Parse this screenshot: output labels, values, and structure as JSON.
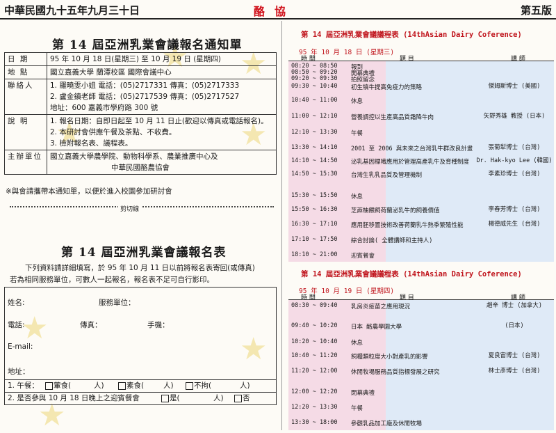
{
  "header": {
    "left": "中華民國九十五年九月三十日",
    "mid": "酪協",
    "right": "第五版"
  },
  "notice": {
    "title": "第 14 屆亞洲乳業會議報名通知單",
    "rows": [
      {
        "label": "日 期",
        "lines": [
          "95 年 10 月 18 日(星期三) 至 10 月 19 日 (星期四)"
        ]
      },
      {
        "label": "地 點",
        "lines": [
          "國立嘉義大學  蘭潭校區  國際會議中心"
        ]
      },
      {
        "label": "聯絡人",
        "lines": [
          "1.   羅曉雯小姐  電話：(05)2717331  傳真：(05)2717333",
          "2.   盧金鎮老師  電話：(05)2717539  傳真：(05)2717527",
          "地址：600 嘉義市學府路 300 號"
        ]
      },
      {
        "label": "說 明",
        "lines": [
          "1.   報名日期：自即日起至 10 月 11 日止(歡迎以傳真或電話報名)。",
          "2.   本研討會供應午餐及茶點、不收費。",
          "3.   檢附報名表、議程表。"
        ]
      },
      {
        "label": "主辦單位",
        "lines": [
          "國立嘉義大學農學院、動物科學系、農業推廣中心及",
          "中華民國酪農協會"
        ]
      }
    ],
    "note": "※與會請攜帶本通知單，以便於進入校園參加研討會"
  },
  "cut_label": "剪切線",
  "registration": {
    "title": "第 14 屆亞洲乳業會議報名表",
    "desc1": "下列資料請詳細填寫，於 95 年 10 月 11 日以前將報名表寄回(或傳真)",
    "desc2": "若為相同服務單位，可數人一起報名，報名表不足可自行影印。",
    "name": "姓名:",
    "unit": "服務單位：",
    "phone": "電話:",
    "fax": "傳真：",
    "mobile": "手機：",
    "email": "E-mail:",
    "address": "地址：",
    "lunch": {
      "label": "1. 午餐：",
      "o1": "葷食(",
      "o2": "素食(",
      "o3": "不拘(",
      "unit": "人)"
    },
    "dinner": {
      "label": "2. 是否參與 10 月 18 日晚上之迎賓餐會",
      "yes": "是(",
      "unit": "人)",
      "no": "否"
    }
  },
  "schedule1": {
    "title": "第 14 屆亞洲乳業會議議程表 (14thAsian Dairy Coference)",
    "date": "95 年 10 月 18 日 (星期三)",
    "head": {
      "time": "時  間",
      "topic": "題    目",
      "speaker": "講    師"
    },
    "rows": [
      {
        "time": "08:20 ~ 08:50",
        "topic": "報到",
        "speaker": ""
      },
      {
        "time": "08:50 ~ 09:20",
        "topic": "開幕典禮",
        "speaker": ""
      },
      {
        "time": "09:20 ~ 09:30",
        "topic": "拍照留念",
        "speaker": ""
      },
      {
        "time": "09:30 ~ 10:40",
        "topic": "初生犢牛提高免疫力的策略",
        "speaker": "傑姆斯博士 (美國)"
      },
      {
        "time": "10:40 ~ 11:00",
        "topic": "休息",
        "speaker": ""
      },
      {
        "time": "11:00 ~ 12:10",
        "topic": "營養調控以生產高品質霜降牛肉",
        "speaker": "矢野秀雄 教授 (日本)"
      },
      {
        "time": "12:10 ~ 13:30",
        "topic": "午餐",
        "speaker": ""
      },
      {
        "time": "13:30 ~ 14:10",
        "topic": "2001 至 2006 與未來之台灣乳牛群改良計畫",
        "speaker": "張菊犁博士 (台灣)"
      },
      {
        "time": "14:10 ~ 14:50",
        "topic": "泌乳基因標幟應用於管理高產乳牛及育種制度",
        "speaker": "Dr. Hak-kyo Lee (韓國)"
      },
      {
        "time": "14:50 ~ 15:30",
        "topic": "台灣生乳乳品質及管理機制",
        "speaker": "李素珍博士 (台灣)"
      },
      {
        "time": "15:30 ~ 15:50",
        "topic": "休息",
        "speaker": ""
      },
      {
        "time": "15:50 ~ 16:30",
        "topic": "芝蔴柚餵飼荷蘭泌乳牛的飼養價值",
        "speaker": "李春芳博士 (台灣)"
      },
      {
        "time": "16:30 ~ 17:10",
        "topic": "應用胚移置技術改善荷蘭乳牛熱季繁殖性能",
        "speaker": "楊德威先生 (台灣)"
      },
      {
        "time": "17:10 ~ 17:50",
        "topic": "綜合討論( 全體講師和主持人)",
        "speaker": ""
      },
      {
        "time": "18:10 ~ 21:00",
        "topic": "迎賓餐會",
        "speaker": ""
      }
    ]
  },
  "schedule2": {
    "title": "第 14 屆亞洲乳業會議議程表 (14thAsian Dairy Coference)",
    "date": "95 年 10 月 19 日 (星期四)",
    "head": {
      "time": "時  間",
      "topic": "題    目",
      "speaker": "講    師"
    },
    "rows": [
      {
        "time": "08:30 ~ 09:40",
        "topic": "乳房炎疫苗之應用現況",
        "speaker": "趙辛 博士 (加拿大)"
      },
      {
        "time": "09:40 ~ 10:20",
        "topic": "日本 酪農學園大學",
        "speaker": "(日本)"
      },
      {
        "time": "10:20 ~ 10:40",
        "topic": "休息",
        "speaker": ""
      },
      {
        "time": "10:40 ~ 11:20",
        "topic": "飼糧類粒度大小對產乳的影響",
        "speaker": "夏良宙博士 (台灣)"
      },
      {
        "time": "11:20 ~ 12:00",
        "topic": "休閒牧場服務品質指標發展之研究",
        "speaker": "林士彥博士 (台灣)"
      },
      {
        "time": "12:00 ~ 12:20",
        "topic": "閉幕典禮",
        "speaker": ""
      },
      {
        "time": "12:20 ~ 13:30",
        "topic": "午餐",
        "speaker": ""
      },
      {
        "time": "13:30 ~ 18:00",
        "topic": "參觀乳品加工廠及休閒牧場",
        "speaker": ""
      }
    ]
  }
}
